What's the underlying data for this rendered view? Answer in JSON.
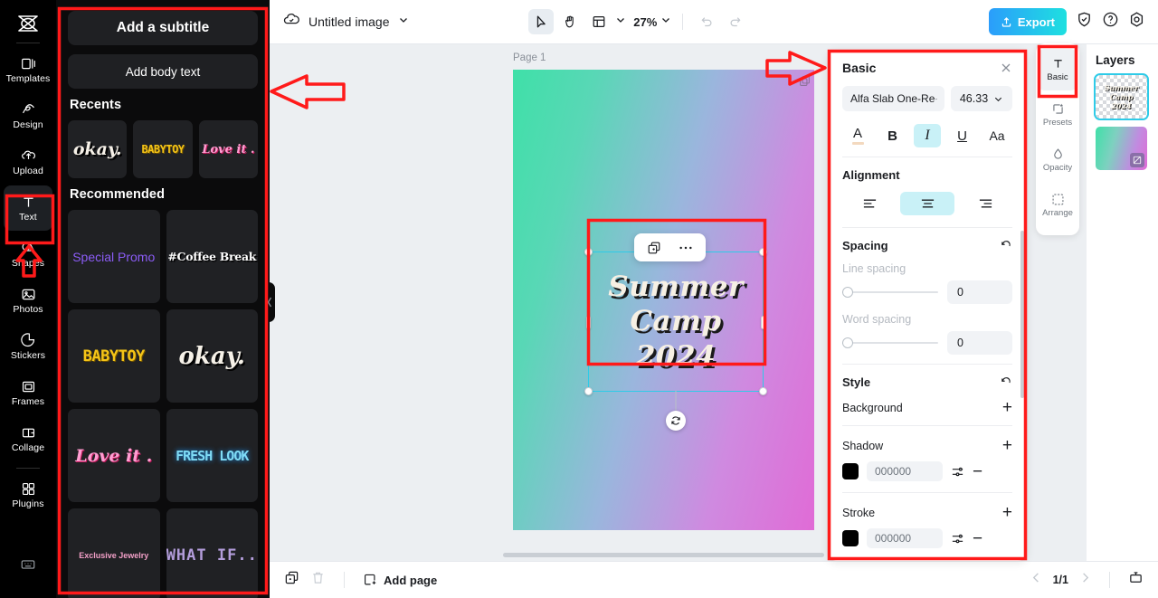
{
  "app": {
    "left_rail": {
      "logo": "capcut-logo-icon",
      "items": [
        {
          "label": "Templates",
          "icon": "templates-icon"
        },
        {
          "label": "Design",
          "icon": "design-icon"
        },
        {
          "label": "Upload",
          "icon": "upload-icon"
        },
        {
          "label": "Text",
          "icon": "text-icon",
          "active": true
        },
        {
          "label": "Shapes",
          "icon": "shapes-icon"
        },
        {
          "label": "Photos",
          "icon": "photos-icon"
        },
        {
          "label": "Stickers",
          "icon": "stickers-icon"
        },
        {
          "label": "Frames",
          "icon": "frames-icon"
        },
        {
          "label": "Collage",
          "icon": "collage-icon"
        },
        {
          "label": "Plugins",
          "icon": "plugins-icon"
        }
      ],
      "bottom_item": {
        "label": "",
        "icon": "keyboard-icon"
      }
    }
  },
  "text_panel": {
    "add_subtitle": "Add a subtitle",
    "add_body_text": "Add body text",
    "recents_heading": "Recents",
    "recents": [
      {
        "label": "okay.",
        "style": "s-okay",
        "size": "19px"
      },
      {
        "label": "BABYTOY",
        "style": "s-baby",
        "size": "12px"
      },
      {
        "label": "Love it .",
        "style": "s-love",
        "size": "13px"
      }
    ],
    "recommended_heading": "Recommended",
    "recommended": [
      {
        "label": "Special Promo",
        "style": "s-promo",
        "size": "14px"
      },
      {
        "label": "#Coffee Break",
        "style": "s-coffee",
        "size": "12.5px"
      },
      {
        "label": "BABYTOY",
        "style": "s-baby",
        "size": "17px"
      },
      {
        "label": "okay.",
        "style": "s-okay",
        "size": "26px"
      },
      {
        "label": "Love it .",
        "style": "s-love",
        "size": "19px"
      },
      {
        "label": "FRESH LOOK",
        "style": "s-fresh",
        "size": "15px"
      },
      {
        "label": "Exclusive Jewelry",
        "style": "s-jewel",
        "size": "9px"
      },
      {
        "label": "WHAT IF..",
        "style": "s-what",
        "size": "17px"
      }
    ]
  },
  "header": {
    "cloud_icon": "cloud-sync-icon",
    "doc_title": "Untitled image",
    "tools": [
      {
        "name": "select-tool",
        "icon": "cursor-icon",
        "selected": true
      },
      {
        "name": "hand-tool",
        "icon": "hand-icon",
        "selected": false
      },
      {
        "name": "layout-tool",
        "icon": "layout-icon",
        "selected": false
      }
    ],
    "zoom": "27%",
    "undo": "undo-icon",
    "redo": "redo-icon",
    "export_label": "Export",
    "export_color": "#24b0f5",
    "shield_icon": "shield-icon",
    "help_icon": "help-icon",
    "settings_icon": "gear-icon"
  },
  "canvas": {
    "page_label": "Page 1",
    "gradient_from": "#3fe0a8",
    "gradient_to": "#e06bd6",
    "selection": {
      "border_color": "#2ecbe8",
      "text_lines": [
        "Summer",
        "Camp",
        "2024"
      ]
    },
    "mini_toolbar": [
      {
        "name": "duplicate-button",
        "icon": "duplicate-icon"
      },
      {
        "name": "more-options-button",
        "icon": "ellipsis-icon"
      }
    ],
    "rotate_handle_icon": "rotate-icon"
  },
  "properties": {
    "title": "Basic",
    "close_icon": "close-icon",
    "font_family": "Alfa Slab One-Re",
    "font_size": "46.33",
    "format_buttons": [
      {
        "name": "text-color-button",
        "glyph": "A",
        "active": false
      },
      {
        "name": "bold-button",
        "glyph": "B",
        "active": false
      },
      {
        "name": "italic-button",
        "glyph": "I",
        "active": true
      },
      {
        "name": "underline-button",
        "glyph": "U",
        "active": false
      },
      {
        "name": "text-case-button",
        "glyph": "Aa",
        "active": false
      }
    ],
    "alignment_label": "Alignment",
    "alignment": [
      {
        "name": "align-left-button",
        "active": false
      },
      {
        "name": "align-center-button",
        "active": true
      },
      {
        "name": "align-right-button",
        "active": false
      }
    ],
    "spacing_label": "Spacing",
    "line_spacing_label": "Line spacing",
    "line_spacing_value": "0",
    "word_spacing_label": "Word spacing",
    "word_spacing_value": "0",
    "style_label": "Style",
    "background_label": "Background",
    "shadow_label": "Shadow",
    "shadow_color": "000000",
    "stroke_label": "Stroke",
    "stroke_color": "000000",
    "reset_icon": "reset-icon",
    "add_icon": "plus-icon",
    "remove_icon": "minus-icon",
    "adjust_icon": "sliders-icon"
  },
  "right_rail": [
    {
      "label": "Basic",
      "icon": "text-basic-icon",
      "active": true
    },
    {
      "label": "Presets",
      "icon": "presets-icon",
      "active": false
    },
    {
      "label": "Opacity",
      "icon": "opacity-icon",
      "active": false
    },
    {
      "label": "Arrange",
      "icon": "arrange-icon",
      "active": false
    }
  ],
  "layers": {
    "title": "Layers",
    "items": [
      {
        "name": "text-layer",
        "type": "text",
        "lines": [
          "Summer",
          "Camp",
          "2024"
        ],
        "selected": true
      },
      {
        "name": "background-layer",
        "type": "gradient",
        "selected": false
      }
    ]
  },
  "footer": {
    "duplicate_page_icon": "duplicate-page-icon",
    "delete_page_icon": "trash-icon",
    "add_page_label": "Add page",
    "add_page_icon": "add-page-icon",
    "prev_icon": "chevron-left-icon",
    "page_indicator": "1/1",
    "next_icon": "chevron-right-icon",
    "present_icon": "present-icon"
  },
  "annotations": {
    "color": "#ff1a1a",
    "boxes": [
      "text-panel-highlight",
      "text-rail-item-highlight",
      "selection-highlight",
      "properties-panel-highlight",
      "basic-tab-highlight"
    ],
    "arrows": [
      "arrow-pointing-left-to-text-panel",
      "arrow-pointing-right-to-properties-panel",
      "arrow-pointing-up-to-text-tool"
    ]
  }
}
